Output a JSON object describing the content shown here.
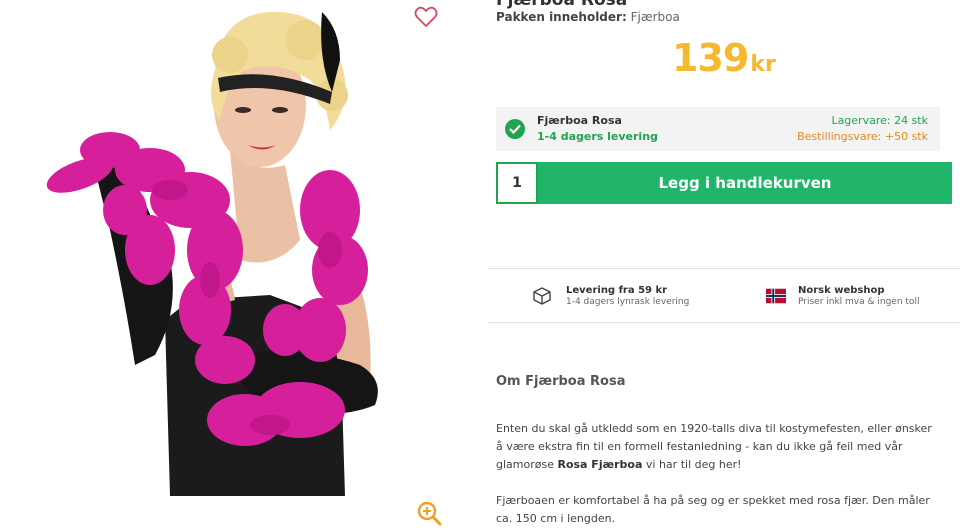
{
  "product": {
    "title": "Fjærboa Rosa",
    "contents_label": "Pakken inneholder:",
    "contents_value": "Fjærboa",
    "price_value": "139",
    "price_currency": "kr"
  },
  "stock": {
    "name": "Fjærboa Rosa",
    "delivery": "1-4 dagers levering",
    "lagervare": "Lagervare: 24 stk",
    "bestillingsvare": "Bestillingsvare: +50 stk"
  },
  "cart": {
    "quantity": "1",
    "button_label": "Legg i handlekurven"
  },
  "usps": [
    {
      "title": "Levering fra 59 kr",
      "subtitle": "1-4 dagers lynrask levering",
      "icon": "box-icon"
    },
    {
      "title": "Norsk webshop",
      "subtitle": "Priser inkl mva & ingen toll",
      "icon": "norway-flag-icon"
    }
  ],
  "about": {
    "title": "Om Fjærboa Rosa",
    "p1_text": "Enten du skal gå utkledd som en 1920-talls diva til kostymefesten, eller ønsker å være ekstra fin til en formell festanledning - kan du ikke gå feil med vår glamorøse ",
    "p1_bold": "Rosa Fjærboa",
    "p1_end": " vi har til deg her!",
    "p2": "Fjærboaen er komfortabel å ha på seg og er spekket med rosa fjær. Den måler ca. 150 cm i lengden."
  },
  "colors": {
    "accent_green": "#21b56a",
    "price_orange": "#f5b82e",
    "boa_pink": "#d6209b",
    "wishlist_red": "#d64a5e"
  },
  "icons": {
    "favorite": "heart-outline-icon",
    "zoom": "zoom-in-icon",
    "stock": "check-circle-icon"
  }
}
